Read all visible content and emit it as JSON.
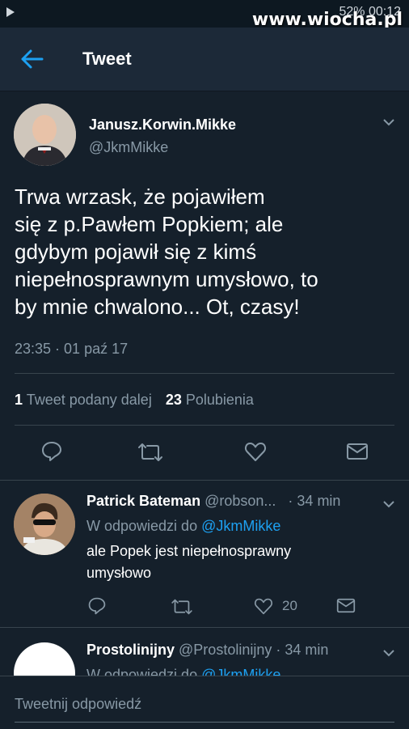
{
  "status_bar": {
    "battery": "52%",
    "time": "00:12"
  },
  "watermark": "www.wiocha.pl",
  "header": {
    "title": "Tweet"
  },
  "tweet": {
    "display_name": "Janusz.Korwin.Mikke",
    "handle": "@JkmMikke",
    "text_lines": [
      "Trwa wrzask, że pojawiłem",
      "się z p.Pawłem Popkiem; ale",
      "gdybym pojawił się z kimś",
      "niepełnosprawnym umysłowo, to",
      "by mnie chwalono... Ot, czasy!"
    ],
    "timestamp": "23:35 · 01 paź 17",
    "retweets_count": "1",
    "retweets_label": "Tweet podany dalej",
    "likes_count": "23",
    "likes_label": "Polubienia"
  },
  "replies": [
    {
      "display_name": "Patrick Bateman",
      "handle": "@robson...",
      "time": "· 34 min",
      "reply_to_prefix": "W odpowiedzi do",
      "reply_to_handle": "@JkmMikke",
      "text_lines": [
        "ale Popek jest niepełnosprawny",
        "umysłowo"
      ],
      "likes": "20"
    },
    {
      "display_name": "Prostolinijny",
      "handle": "@Prostolinijny",
      "time": "· 34 min",
      "reply_to_prefix": "W odpowiedzi do",
      "reply_to_handle": "@JkmMikke"
    }
  ],
  "compose": {
    "placeholder": "Tweetnij odpowiedź"
  },
  "colors": {
    "background": "#15202b",
    "header": "#1c2938",
    "accent": "#1da1f2",
    "muted": "#8899a6"
  }
}
